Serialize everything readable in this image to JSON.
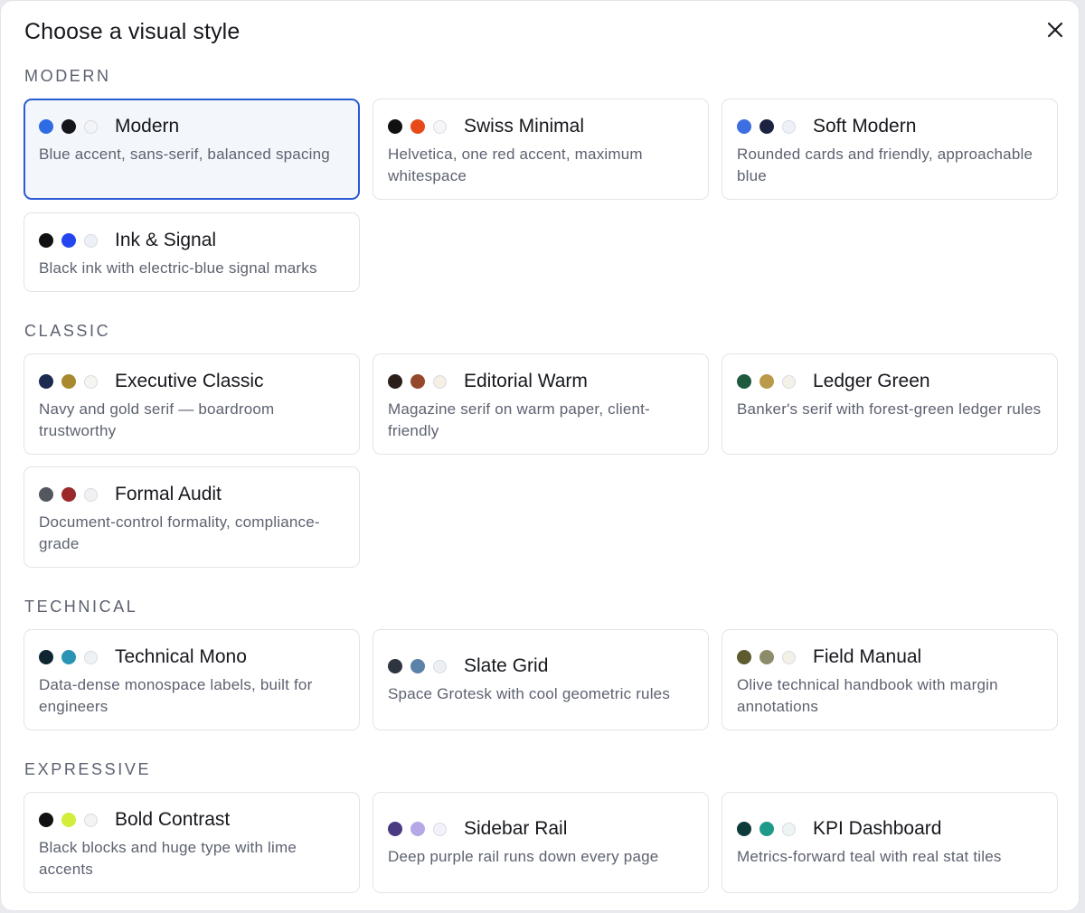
{
  "dialog": {
    "title": "Choose a visual style"
  },
  "sections": [
    {
      "label": "MODERN",
      "items": [
        {
          "title": "Modern",
          "desc": "Blue accent, sans-serif, balanced spacing",
          "swatches": [
            "#2f6be2",
            "#14161c",
            "#f3f4f7"
          ],
          "selected": true
        },
        {
          "title": "Swiss Minimal",
          "desc": "Helvetica, one red accent, maximum whitespace",
          "swatches": [
            "#111111",
            "#e64a19",
            "#f6f6f6"
          ]
        },
        {
          "title": "Soft Modern",
          "desc": "Rounded cards and friendly, approachable blue",
          "swatches": [
            "#3d6fe0",
            "#1c2340",
            "#eef1f8"
          ]
        },
        {
          "title": "Ink & Signal",
          "desc": "Black ink with electric-blue signal marks",
          "swatches": [
            "#111111",
            "#2346f0",
            "#eef0f8"
          ]
        }
      ]
    },
    {
      "label": "CLASSIC",
      "items": [
        {
          "title": "Executive Classic",
          "desc": "Navy and gold serif — boardroom trustworthy",
          "swatches": [
            "#1b2a4e",
            "#a8892e",
            "#f7f5ef"
          ]
        },
        {
          "title": "Editorial Warm",
          "desc": "Magazine serif on warm paper, client-friendly",
          "swatches": [
            "#2a1f1a",
            "#94492c",
            "#f5efe4"
          ]
        },
        {
          "title": "Ledger Green",
          "desc": "Banker's serif with forest-green ledger rules",
          "swatches": [
            "#1f5a3f",
            "#b89a4a",
            "#f4f1e8"
          ]
        },
        {
          "title": "Formal Audit",
          "desc": "Document-control formality, compliance-grade",
          "swatches": [
            "#55575f",
            "#9a2a2a",
            "#f1f1f1"
          ]
        }
      ]
    },
    {
      "label": "TECHNICAL",
      "items": [
        {
          "title": "Technical Mono",
          "desc": "Data-dense monospace labels, built for engineers",
          "swatches": [
            "#0f2530",
            "#2a94b4",
            "#eef2f5"
          ]
        },
        {
          "title": "Slate Grid",
          "desc": "Space Grotesk with cool geometric rules",
          "swatches": [
            "#2e3440",
            "#5b82a8",
            "#eceff4"
          ]
        },
        {
          "title": "Field Manual",
          "desc": "Olive technical handbook with margin annotations",
          "swatches": [
            "#5c5c2e",
            "#8d8c6a",
            "#f3f1e6"
          ]
        }
      ]
    },
    {
      "label": "EXPRESSIVE",
      "items": [
        {
          "title": "Bold Contrast",
          "desc": "Black blocks and huge type with lime accents",
          "swatches": [
            "#111111",
            "#d4ec3a",
            "#f3f3f3"
          ]
        },
        {
          "title": "Sidebar Rail",
          "desc": "Deep purple rail runs down every page",
          "swatches": [
            "#4a3a82",
            "#b6a7e6",
            "#f3f1fa"
          ]
        },
        {
          "title": "KPI Dashboard",
          "desc": "Metrics-forward teal with real stat tiles",
          "swatches": [
            "#0e3a3a",
            "#1e9a8a",
            "#eef4f3"
          ]
        }
      ]
    }
  ]
}
